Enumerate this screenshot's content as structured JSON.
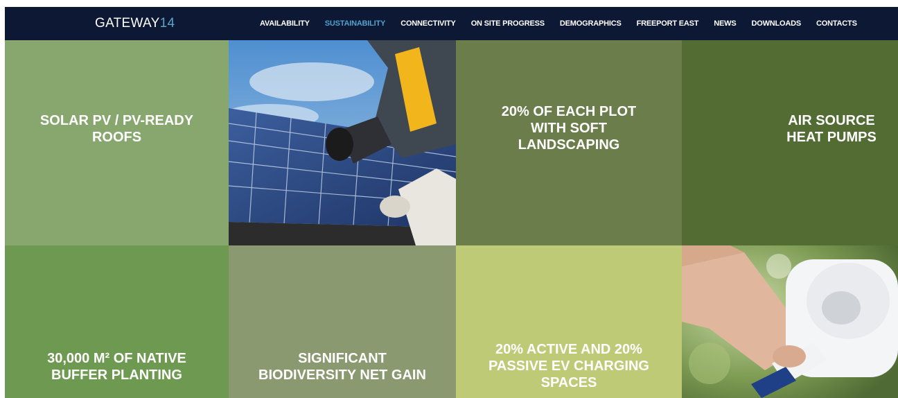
{
  "header": {
    "logo_text": "GATEWAY",
    "logo_number": "14",
    "nav": [
      {
        "label": "AVAILABILITY",
        "active": false
      },
      {
        "label": "SUSTAINABILITY",
        "active": true
      },
      {
        "label": "CONNECTIVITY",
        "active": false
      },
      {
        "label": "ON SITE PROGRESS",
        "active": false
      },
      {
        "label": "DEMOGRAPHICS",
        "active": false
      },
      {
        "label": "FREEPORT EAST",
        "active": false
      },
      {
        "label": "NEWS",
        "active": false
      },
      {
        "label": "DOWNLOADS",
        "active": false
      },
      {
        "label": "CONTACTS",
        "active": false
      }
    ]
  },
  "tiles": {
    "solar": {
      "line1": "SOLAR PV / PV-READY",
      "line2": "ROOFS"
    },
    "landscaping": {
      "line1": "20% OF EACH PLOT",
      "line2": "WITH SOFT",
      "line3": "LANDSCAPING"
    },
    "heat_pumps": {
      "line1": "AIR SOURCE",
      "line2": "HEAT PUMPS"
    },
    "buffer": {
      "line1": "30,000 M² OF NATIVE",
      "line2": "BUFFER PLANTING"
    },
    "biodiversity": {
      "line1": "SIGNIFICANT",
      "line2": "BIODIVERSITY NET GAIN"
    },
    "ev": {
      "line1": "20% ACTIVE AND 20%",
      "line2": "PASSIVE EV CHARGING",
      "line3": "SPACES"
    }
  },
  "colors": {
    "nav_bg": "#0c1834",
    "active_link": "#4ea3cd",
    "tile_light_green": "#88a76f",
    "tile_olive": "#6c7d4c",
    "tile_dark_green": "#526c34",
    "tile_mid_green": "#6e9950",
    "tile_sage": "#8a996f",
    "tile_lime": "#bfca76"
  },
  "images": {
    "solar_photo": "worker-installing-solar-panel-photo",
    "ev_photo": "hand-plugging-ev-charger-photo"
  }
}
